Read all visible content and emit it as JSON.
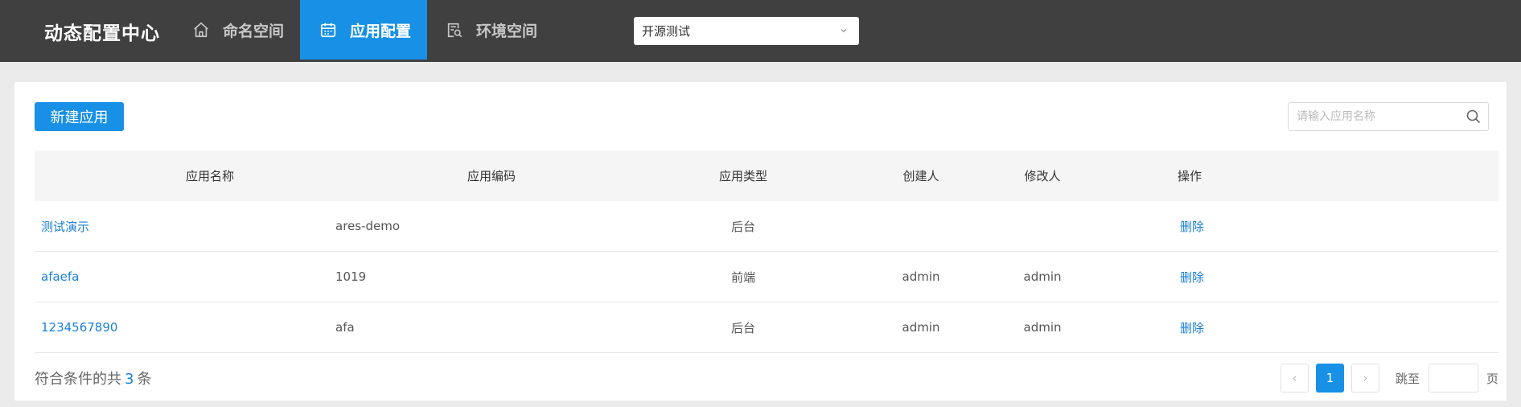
{
  "header": {
    "brand": "动态配置中心",
    "nav": [
      {
        "label": "命名空间",
        "icon": "home-icon"
      },
      {
        "label": "应用配置",
        "icon": "calendar-icon",
        "active": true
      },
      {
        "label": "环境空间",
        "icon": "search-document-icon"
      }
    ],
    "env_select": {
      "value": "开源测试"
    }
  },
  "toolbar": {
    "new_button": "新建应用",
    "search_placeholder": "请输入应用名称"
  },
  "table": {
    "columns": [
      "应用名称",
      "应用编码",
      "应用类型",
      "创建人",
      "修改人",
      "操作"
    ],
    "rows": [
      {
        "name": "测试演示",
        "code": "ares-demo",
        "type": "后台",
        "creator": "",
        "modifier": "",
        "action": "删除"
      },
      {
        "name": "afaefa",
        "code": "1019",
        "type": "前端",
        "creator": "admin",
        "modifier": "admin",
        "action": "删除"
      },
      {
        "name": "1234567890",
        "code": "afa",
        "type": "后台",
        "creator": "admin",
        "modifier": "admin",
        "action": "删除"
      }
    ]
  },
  "footer": {
    "total_prefix": "符合条件的共",
    "total_count": "3",
    "total_suffix": "条",
    "pagination": {
      "prev": "‹",
      "current_page": "1",
      "next": "›",
      "jump_label": "跳至",
      "page_unit": "页"
    }
  },
  "colors": {
    "accent": "#1890e6",
    "topbar": "#404040",
    "link": "#1a7fd8"
  }
}
